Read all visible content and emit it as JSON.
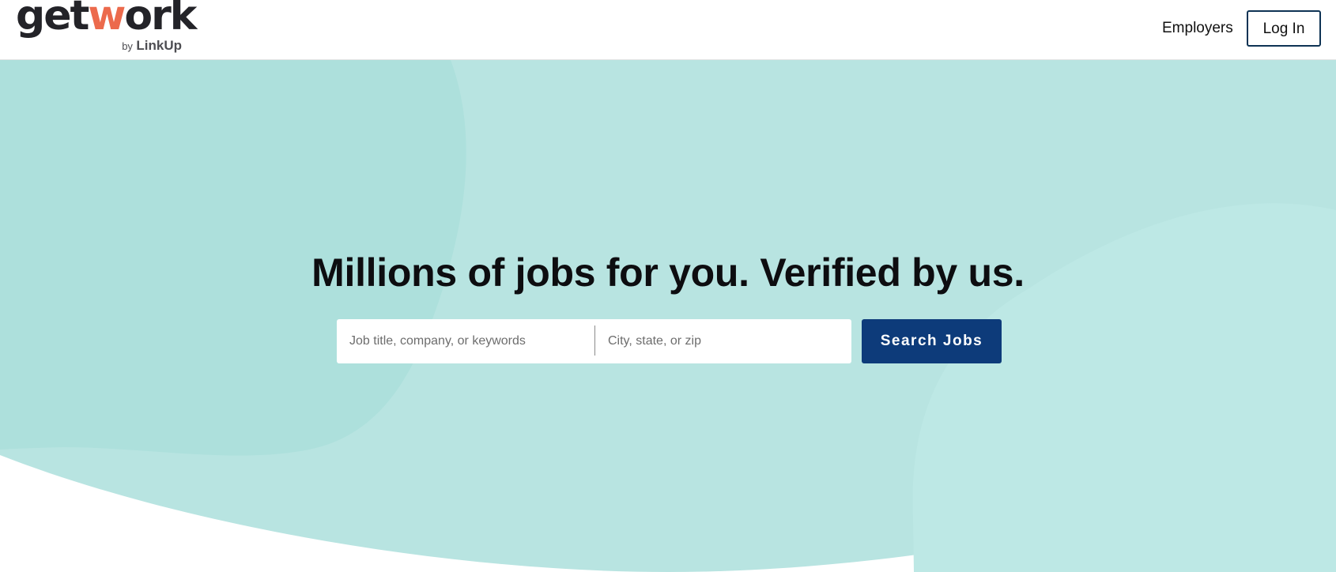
{
  "brand": {
    "logo_prefix": "get",
    "logo_accent": "w",
    "logo_suffix": "ork",
    "logo_by": "by",
    "logo_partner": "LinkUp",
    "accent_color": "#ec6a4c"
  },
  "nav": {
    "employers_label": "Employers",
    "login_label": "Log In"
  },
  "hero": {
    "title": "Millions of jobs for you. Verified by us.",
    "background_color": "#b8e4e1"
  },
  "search": {
    "keywords_placeholder": "Job title, company, or keywords",
    "keywords_value": "",
    "location_placeholder": "City, state, or zip",
    "location_value": "",
    "button_label": "Search Jobs",
    "button_color": "#0d3b7a"
  }
}
